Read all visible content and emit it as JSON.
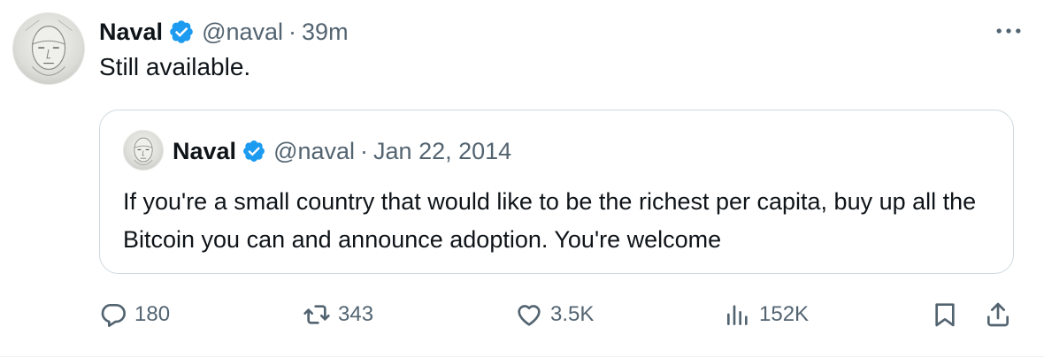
{
  "tweet": {
    "author": {
      "name": "Naval",
      "handle": "@naval",
      "verified": true,
      "avatar": "sketched-face-avatar"
    },
    "separator": "·",
    "time": "39m",
    "text": "Still available.",
    "more_icon": "ellipsis-icon"
  },
  "quoted_tweet": {
    "author": {
      "name": "Naval",
      "handle": "@naval",
      "verified": true,
      "avatar": "sketched-face-avatar"
    },
    "separator": "·",
    "date": "Jan 22, 2014",
    "text": "If you're a small country that would like to be the richest per capita, buy up all the Bitcoin you can and announce adoption. You're welcome"
  },
  "actions": {
    "replies": {
      "icon": "reply-icon",
      "count": "180"
    },
    "retweets": {
      "icon": "retweet-icon",
      "count": "343"
    },
    "likes": {
      "icon": "heart-icon",
      "count": "3.5K"
    },
    "views": {
      "icon": "views-icon",
      "count": "152K"
    },
    "bookmark": {
      "icon": "bookmark-icon"
    },
    "share": {
      "icon": "share-icon"
    }
  },
  "colors": {
    "text_primary": "#0f1419",
    "text_secondary": "#536471",
    "verified_blue": "#1d9bf0",
    "border": "#cfd9de"
  }
}
